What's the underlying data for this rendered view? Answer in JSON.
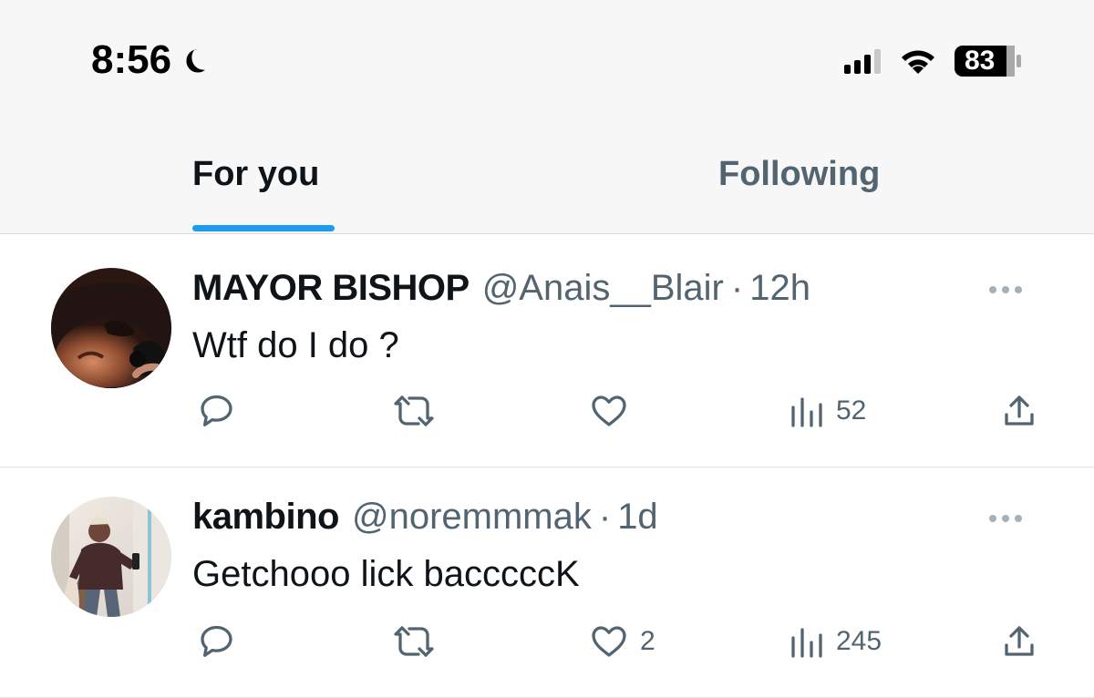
{
  "status_bar": {
    "time": "8:56",
    "battery": "83",
    "icons": [
      "moon-icon",
      "signal-icon",
      "wifi-icon",
      "battery-icon"
    ]
  },
  "tabs": [
    {
      "label": "For you",
      "active": true
    },
    {
      "label": "Following",
      "active": false
    }
  ],
  "tweets": [
    {
      "display_name": "MAYOR BISHOP",
      "handle": "@Anais__Blair",
      "separator": "·",
      "time_ago": "12h",
      "text": "Wtf do I do ?",
      "counts": {
        "replies": "",
        "retweets": "",
        "likes": "",
        "views": "52"
      }
    },
    {
      "display_name": "kambino",
      "handle": "@noremmmak",
      "separator": "·",
      "time_ago": "1d",
      "text": "Getchooo lick bacccccK",
      "counts": {
        "replies": "",
        "retweets": "",
        "likes": "2",
        "views": "245"
      }
    }
  ],
  "colors": {
    "accent": "#1d9bf0",
    "primary_text": "#0f1419",
    "secondary_text": "#536471",
    "divider": "#dfe3e6"
  }
}
